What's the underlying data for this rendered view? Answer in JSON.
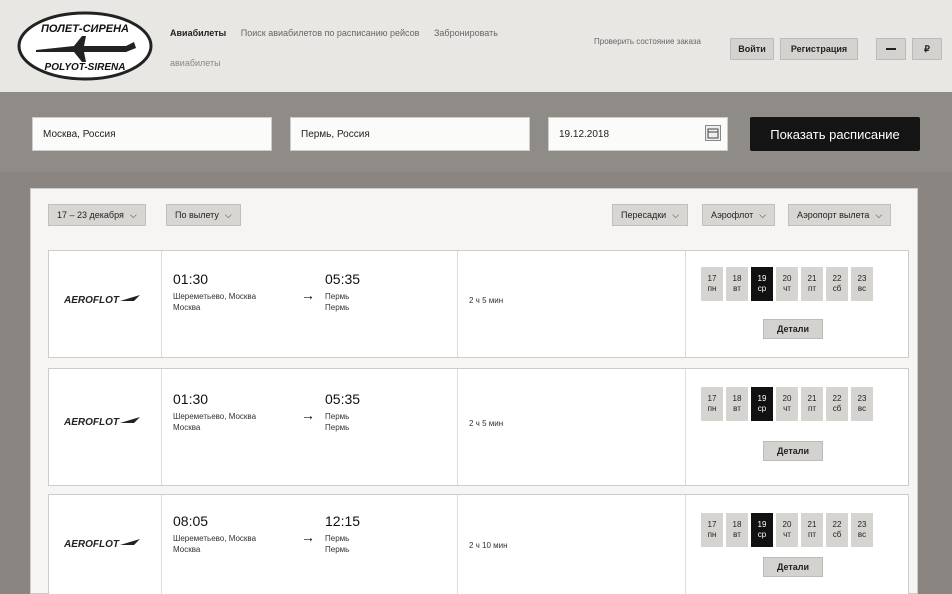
{
  "header": {
    "logo_text_top": "ПОЛЕТ-СИРЕНА",
    "logo_text_bottom": "POLYOT-SIRENA",
    "nav": [
      "Авиабилеты",
      "Поиск авиабилетов по расписанию рейсов",
      "Забронировать"
    ],
    "nav_sub": "авиабилеты",
    "check_status": "Проверить состояние заказа",
    "login": "Войти",
    "register": "Регистрация",
    "lang_short": "₽"
  },
  "search": {
    "from": "Москва, Россия",
    "to": "Пермь, Россия",
    "date": "19.12.2018",
    "submit": "Показать расписание"
  },
  "filters": {
    "dates": "17 – 23 декабря",
    "sort": "По вылету",
    "transfers": "Пересадки",
    "airline": "Аэрофлот",
    "departure_airport": "Аэропорт вылета"
  },
  "results": [
    {
      "airline": "AEROFLOT",
      "dep_time": "01:30",
      "dep_place": [
        "Шереметьево, Москва",
        "Москва"
      ],
      "arr_time": "05:35",
      "arr_place": [
        "Пермь",
        "Пермь"
      ],
      "duration": "2 ч 5 мин",
      "details": "Детали"
    },
    {
      "airline": "AEROFLOT",
      "dep_time": "01:30",
      "dep_place": [
        "Шереметьево, Москва",
        "Москва"
      ],
      "arr_time": "05:35",
      "arr_place": [
        "Пермь",
        "Пермь"
      ],
      "duration": "2 ч 5 мин",
      "details": "Детали"
    },
    {
      "airline": "AEROFLOT",
      "dep_time": "08:05",
      "dep_place": [
        "Шереметьево, Москва",
        "Москва"
      ],
      "arr_time": "12:15",
      "arr_place": [
        "Пермь",
        "Пермь"
      ],
      "duration": "2 ч 10 мин",
      "details": "Детали"
    }
  ],
  "days": [
    {
      "num": "17",
      "dow": "пн"
    },
    {
      "num": "18",
      "dow": "вт"
    },
    {
      "num": "19",
      "dow": "ср"
    },
    {
      "num": "20",
      "dow": "чт"
    },
    {
      "num": "21",
      "dow": "пт"
    },
    {
      "num": "22",
      "dow": "сб"
    },
    {
      "num": "23",
      "dow": "вс"
    }
  ],
  "selected_day": "19",
  "icons": {
    "arrow": "arrow-right-icon",
    "calendar": "calendar-icon",
    "chevron": "chevron-down-icon",
    "menu": "menu-icon"
  }
}
